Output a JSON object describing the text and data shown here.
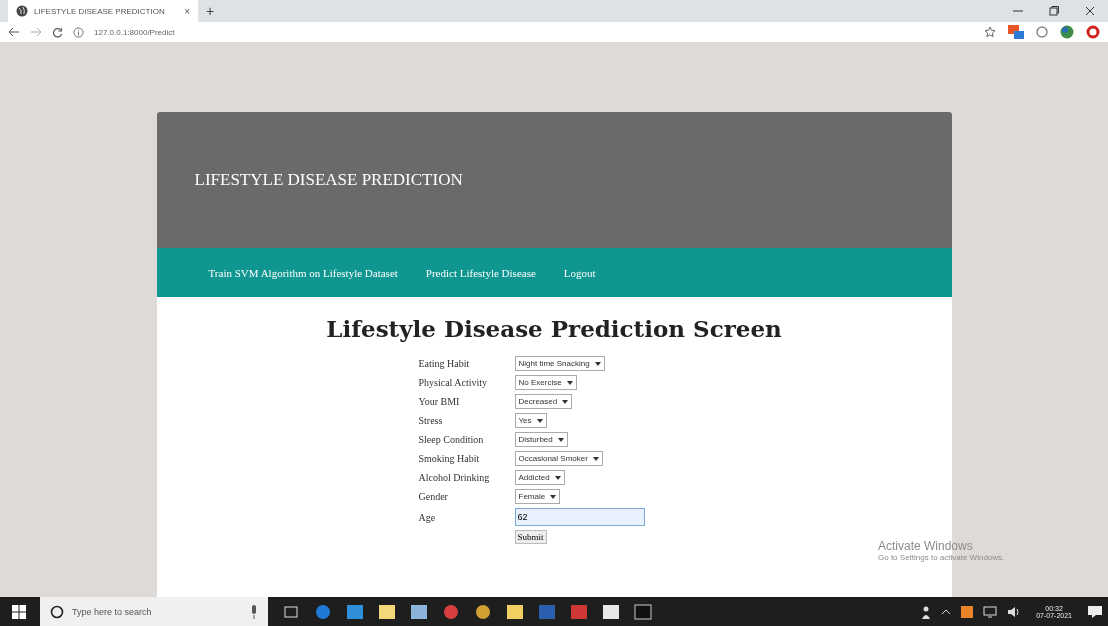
{
  "browser": {
    "tab_title": "LIFESTYLE DISEASE PREDICTION",
    "tab_close": "×",
    "new_tab": "+",
    "url": "127.0.0.1:8000/Predict"
  },
  "header": {
    "title": "LIFESTYLE DISEASE PREDICTION"
  },
  "nav": [
    {
      "label": "Train SVM Algorithm on Lifestyle Dataset"
    },
    {
      "label": "Predict Lifestyle Disease"
    },
    {
      "label": "Logout"
    }
  ],
  "page_title": "Lifestyle Disease Prediction Screen",
  "form": [
    {
      "label": "Eating Habit",
      "kind": "select",
      "value": "Night time Snacking"
    },
    {
      "label": "Physical Activity",
      "kind": "select",
      "value": "No Exercise"
    },
    {
      "label": "Your BMI",
      "kind": "select",
      "value": "Decreased"
    },
    {
      "label": "Stress",
      "kind": "select",
      "value": "Yes"
    },
    {
      "label": "Sleep Condition",
      "kind": "select",
      "value": "Disturbed"
    },
    {
      "label": "Smoking Habit",
      "kind": "select",
      "value": "Occasional Smoker"
    },
    {
      "label": "Alcohol Drinking",
      "kind": "select",
      "value": "Addicted"
    },
    {
      "label": "Gender",
      "kind": "select",
      "value": "Female"
    },
    {
      "label": "Age",
      "kind": "input",
      "value": "62"
    }
  ],
  "submit": "Submit",
  "activation": {
    "title": "Activate Windows",
    "text": "Go to Settings to activate Windows."
  },
  "taskbar": {
    "search_placeholder": "Type here to search",
    "time": "00:32",
    "date": "07-07-2021"
  }
}
